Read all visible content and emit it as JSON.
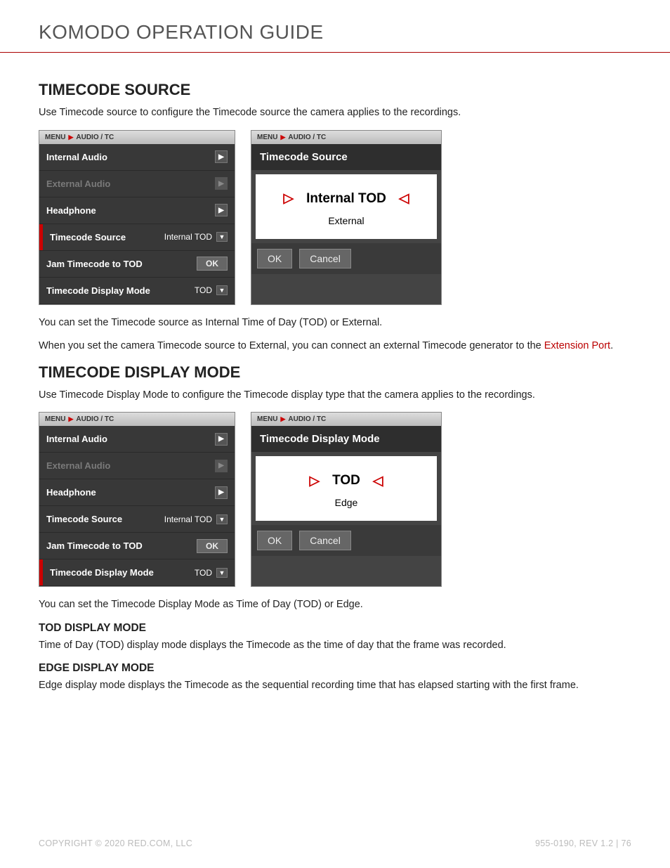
{
  "doc": {
    "title": "KOMODO OPERATION GUIDE"
  },
  "section1": {
    "heading": "TIMECODE SOURCE",
    "intro": "Use Timecode source to configure the Timecode source the camera applies to the recordings.",
    "para1": "You can set the Timecode source as Internal Time of Day (TOD) or External.",
    "para2a": "When you set the camera Timecode source to External, you can connect an external Timecode generator to the ",
    "para2_link": "Extension Port",
    "para2b": "."
  },
  "section2": {
    "heading": "TIMECODE DISPLAY MODE",
    "intro": "Use Timecode Display Mode to configure the Timecode display type that the camera applies to the recordings.",
    "para1": "You can set the Timecode Display Mode as Time of Day (TOD) or Edge."
  },
  "sub_tod": {
    "heading": "TOD DISPLAY MODE",
    "text": "Time of Day (TOD) display mode displays the Timecode as the time of day that the frame was recorded."
  },
  "sub_edge": {
    "heading": "EDGE DISPLAY MODE",
    "text": "Edge display mode displays the Timecode as the sequential recording time that has elapsed starting with the first frame."
  },
  "breadcrumb": {
    "menu": "MENU",
    "path": "AUDIO / TC"
  },
  "menuA": {
    "active_index": 3,
    "items": [
      {
        "label": "Internal Audio",
        "type": "chevron",
        "enabled": true
      },
      {
        "label": "External Audio",
        "type": "chevron",
        "enabled": false
      },
      {
        "label": "Headphone",
        "type": "chevron",
        "enabled": true
      },
      {
        "label": "Timecode Source",
        "type": "dropdown",
        "value": "Internal TOD"
      },
      {
        "label": "Jam Timecode to TOD",
        "type": "ok"
      },
      {
        "label": "Timecode Display Mode",
        "type": "dropdown",
        "value": "TOD"
      }
    ]
  },
  "menuB": {
    "active_index": 5,
    "items": [
      {
        "label": "Internal Audio",
        "type": "chevron",
        "enabled": true
      },
      {
        "label": "External Audio",
        "type": "chevron",
        "enabled": false
      },
      {
        "label": "Headphone",
        "type": "chevron",
        "enabled": true
      },
      {
        "label": "Timecode Source",
        "type": "dropdown",
        "value": "Internal TOD"
      },
      {
        "label": "Jam Timecode to TOD",
        "type": "ok"
      },
      {
        "label": "Timecode Display Mode",
        "type": "dropdown",
        "value": "TOD"
      }
    ]
  },
  "picker1": {
    "title": "Timecode Source",
    "selected": "Internal TOD",
    "alt": "External",
    "ok": "OK",
    "cancel": "Cancel"
  },
  "picker2": {
    "title": "Timecode Display Mode",
    "selected": "TOD",
    "alt": "Edge",
    "ok": "OK",
    "cancel": "Cancel"
  },
  "common": {
    "ok": "OK"
  },
  "footer": {
    "copyright": "COPYRIGHT © 2020 RED.COM, LLC",
    "rev": "955-0190, REV 1.2  |  76"
  }
}
